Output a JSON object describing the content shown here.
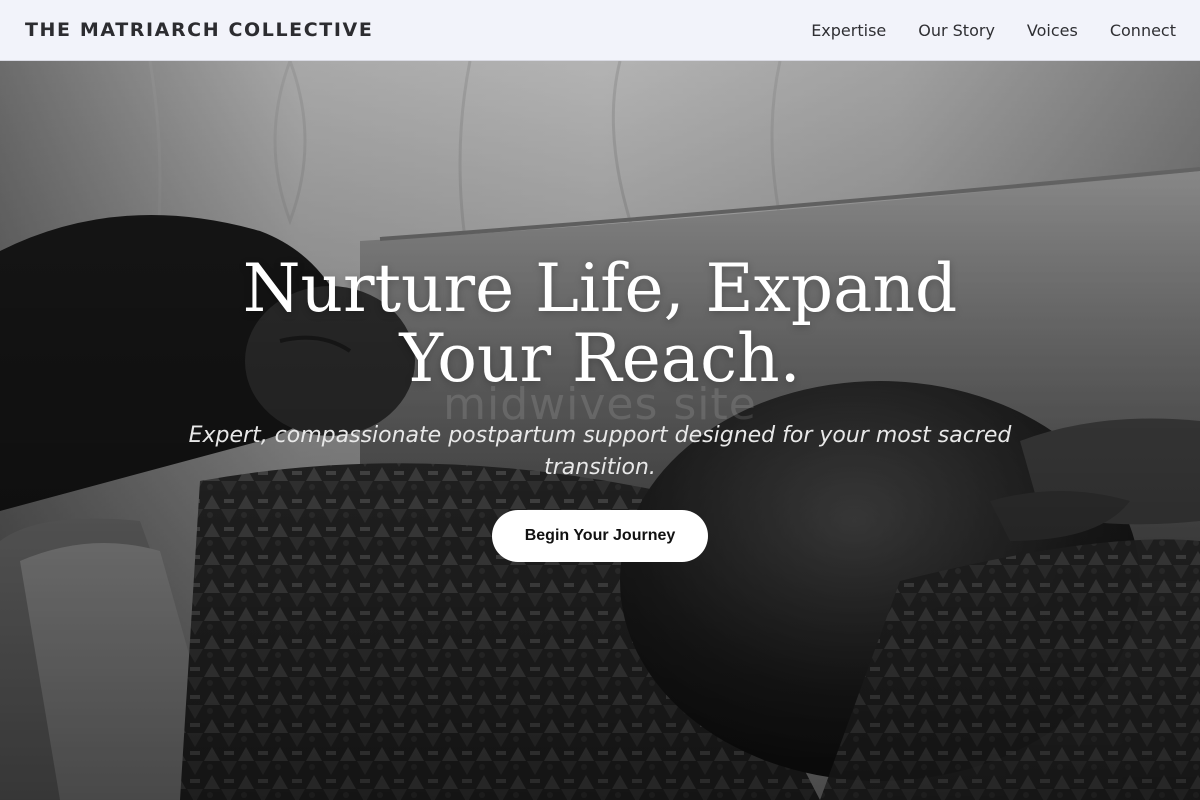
{
  "header": {
    "brand": "THE MATRIARCH COLLECTIVE",
    "nav": [
      {
        "label": "Expertise"
      },
      {
        "label": "Our Story"
      },
      {
        "label": "Voices"
      },
      {
        "label": "Connect"
      }
    ]
  },
  "hero": {
    "headline": "Nurture Life, Expand Your Reach.",
    "watermark": "midwives site",
    "subheadline": "Expert, compassionate postpartum support designed for your most sacred transition.",
    "cta_label": "Begin Your Journey",
    "image": "black-and-white photo of a pregnant woman resting on a couch"
  },
  "colors": {
    "header_bg": "#f2f3fa",
    "text_dark": "#2c2c30",
    "cta_bg": "#ffffff"
  }
}
